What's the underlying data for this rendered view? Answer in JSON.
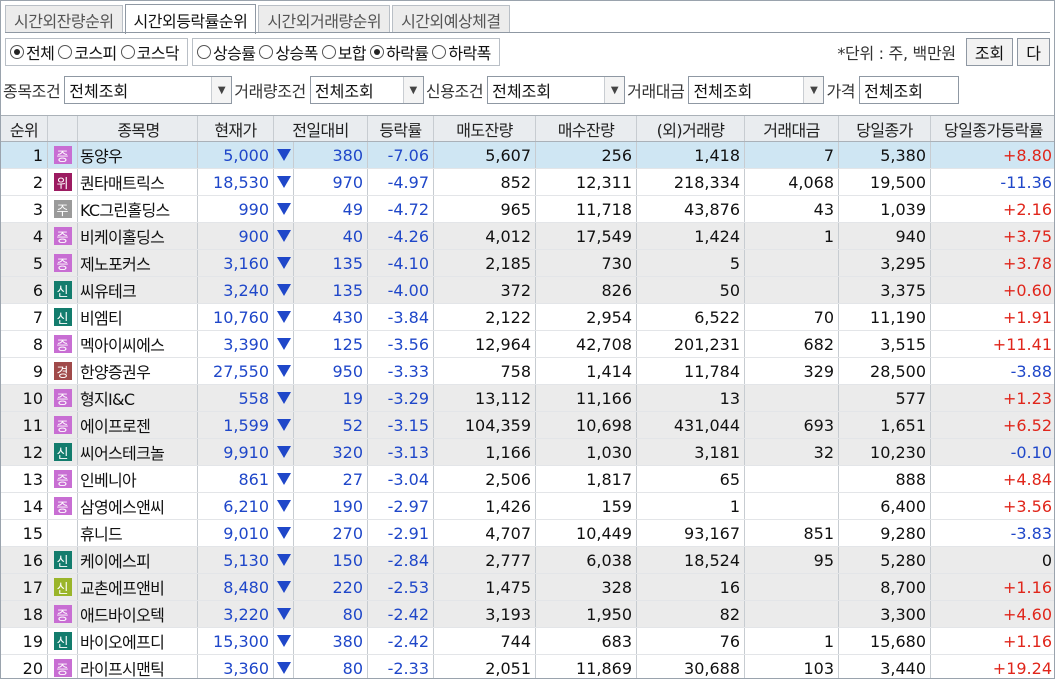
{
  "tabs": [
    "시간외잔량순위",
    "시간외등락률순위",
    "시간외거래량순위",
    "시간외예상체결"
  ],
  "active_tab": 1,
  "market_radios": [
    {
      "label": "전체",
      "checked": true
    },
    {
      "label": "코스피",
      "checked": false
    },
    {
      "label": "코스닥",
      "checked": false
    }
  ],
  "direction_radios": [
    {
      "label": "상승률",
      "checked": false
    },
    {
      "label": "상승폭",
      "checked": false
    },
    {
      "label": "보합",
      "checked": false
    },
    {
      "label": "하락률",
      "checked": true
    },
    {
      "label": "하락폭",
      "checked": false
    }
  ],
  "unit_label": "*단위 : 주, 백만원",
  "query_button": "조회",
  "next_button": "다",
  "filters": [
    {
      "label": "종목조건",
      "value": "전체조회"
    },
    {
      "label": "거래량조건",
      "value": "전체조회"
    },
    {
      "label": "신용조건",
      "value": "전체조회"
    },
    {
      "label": "거래대금",
      "value": "전체조회"
    },
    {
      "label": "가격",
      "value": "전체조회"
    }
  ],
  "columns": [
    "순위",
    "",
    "종목명",
    "현재가",
    "전일대비",
    "등락률",
    "매도잔량",
    "매수잔량",
    "(외)거래량",
    "거래대금",
    "당일종가",
    "당일종가등락률"
  ],
  "colors": {
    "down": "#1f47c9",
    "up": "#e0261b",
    "selected_row": "#cfe6f3",
    "badge_jeung": "#c86ed3",
    "badge_sin": "#137c6d",
    "badge_wi": "#9c1b61",
    "badge_ju": "#9a9a9a",
    "badge_gyeong": "#a04a4a",
    "badge_sin_light": "#9ab52a"
  },
  "rows": [
    {
      "rank": "1",
      "badge": "증",
      "badge_color": "#c86ed3",
      "name": "동양우",
      "price": "5,000",
      "change": "380",
      "rate": "-7.06",
      "sell": "5,607",
      "buy": "256",
      "volume": "1,418",
      "amount": "7",
      "close": "5,380",
      "close_rate": "+8.80",
      "close_color": "#e0261b"
    },
    {
      "rank": "2",
      "badge": "위",
      "badge_color": "#9c1b61",
      "name": "퀀타매트릭스",
      "price": "18,530",
      "change": "970",
      "rate": "-4.97",
      "sell": "852",
      "buy": "12,311",
      "volume": "218,334",
      "amount": "4,068",
      "close": "19,500",
      "close_rate": "-11.36",
      "close_color": "#1f47c9"
    },
    {
      "rank": "3",
      "badge": "주",
      "badge_color": "#9a9a9a",
      "name": "KC그린홀딩스",
      "price": "990",
      "change": "49",
      "rate": "-4.72",
      "sell": "965",
      "buy": "11,718",
      "volume": "43,876",
      "amount": "43",
      "close": "1,039",
      "close_rate": "+2.16",
      "close_color": "#e0261b"
    },
    {
      "rank": "4",
      "badge": "증",
      "badge_color": "#c86ed3",
      "name": "비케이홀딩스",
      "price": "900",
      "change": "40",
      "rate": "-4.26",
      "sell": "4,012",
      "buy": "17,549",
      "volume": "1,424",
      "amount": "1",
      "close": "940",
      "close_rate": "+3.75",
      "close_color": "#e0261b"
    },
    {
      "rank": "5",
      "badge": "증",
      "badge_color": "#c86ed3",
      "name": "제노포커스",
      "price": "3,160",
      "change": "135",
      "rate": "-4.10",
      "sell": "2,185",
      "buy": "730",
      "volume": "5",
      "amount": "",
      "close": "3,295",
      "close_rate": "+3.78",
      "close_color": "#e0261b"
    },
    {
      "rank": "6",
      "badge": "신",
      "badge_color": "#137c6d",
      "name": "씨유테크",
      "price": "3,240",
      "change": "135",
      "rate": "-4.00",
      "sell": "372",
      "buy": "826",
      "volume": "50",
      "amount": "",
      "close": "3,375",
      "close_rate": "+0.60",
      "close_color": "#e0261b"
    },
    {
      "rank": "7",
      "badge": "신",
      "badge_color": "#137c6d",
      "name": "비엠티",
      "price": "10,760",
      "change": "430",
      "rate": "-3.84",
      "sell": "2,122",
      "buy": "2,954",
      "volume": "6,522",
      "amount": "70",
      "close": "11,190",
      "close_rate": "+1.91",
      "close_color": "#e0261b"
    },
    {
      "rank": "8",
      "badge": "증",
      "badge_color": "#c86ed3",
      "name": "멕아이씨에스",
      "price": "3,390",
      "change": "125",
      "rate": "-3.56",
      "sell": "12,964",
      "buy": "42,708",
      "volume": "201,231",
      "amount": "682",
      "close": "3,515",
      "close_rate": "+11.41",
      "close_color": "#e0261b"
    },
    {
      "rank": "9",
      "badge": "경",
      "badge_color": "#a04a4a",
      "name": "한양증권우",
      "price": "27,550",
      "change": "950",
      "rate": "-3.33",
      "sell": "758",
      "buy": "1,414",
      "volume": "11,784",
      "amount": "329",
      "close": "28,500",
      "close_rate": "-3.88",
      "close_color": "#1f47c9"
    },
    {
      "rank": "10",
      "badge": "증",
      "badge_color": "#c86ed3",
      "name": "형지I&C",
      "price": "558",
      "change": "19",
      "rate": "-3.29",
      "sell": "13,112",
      "buy": "11,166",
      "volume": "13",
      "amount": "",
      "close": "577",
      "close_rate": "+1.23",
      "close_color": "#e0261b"
    },
    {
      "rank": "11",
      "badge": "증",
      "badge_color": "#c86ed3",
      "name": "에이프로젠",
      "price": "1,599",
      "change": "52",
      "rate": "-3.15",
      "sell": "104,359",
      "buy": "10,698",
      "volume": "431,044",
      "amount": "693",
      "close": "1,651",
      "close_rate": "+6.52",
      "close_color": "#e0261b"
    },
    {
      "rank": "12",
      "badge": "신",
      "badge_color": "#137c6d",
      "name": "씨어스테크놀",
      "price": "9,910",
      "change": "320",
      "rate": "-3.13",
      "sell": "1,166",
      "buy": "1,030",
      "volume": "3,181",
      "amount": "32",
      "close": "10,230",
      "close_rate": "-0.10",
      "close_color": "#1f47c9"
    },
    {
      "rank": "13",
      "badge": "증",
      "badge_color": "#c86ed3",
      "name": "인베니아",
      "price": "861",
      "change": "27",
      "rate": "-3.04",
      "sell": "2,506",
      "buy": "1,817",
      "volume": "65",
      "amount": "",
      "close": "888",
      "close_rate": "+4.84",
      "close_color": "#e0261b"
    },
    {
      "rank": "14",
      "badge": "증",
      "badge_color": "#c86ed3",
      "name": "삼영에스앤씨",
      "price": "6,210",
      "change": "190",
      "rate": "-2.97",
      "sell": "1,426",
      "buy": "159",
      "volume": "1",
      "amount": "",
      "close": "6,400",
      "close_rate": "+3.56",
      "close_color": "#e0261b"
    },
    {
      "rank": "15",
      "badge": "",
      "badge_color": "",
      "name": "휴니드",
      "price": "9,010",
      "change": "270",
      "rate": "-2.91",
      "sell": "4,707",
      "buy": "10,449",
      "volume": "93,167",
      "amount": "851",
      "close": "9,280",
      "close_rate": "-3.83",
      "close_color": "#1f47c9"
    },
    {
      "rank": "16",
      "badge": "신",
      "badge_color": "#137c6d",
      "name": "케이에스피",
      "price": "5,130",
      "change": "150",
      "rate": "-2.84",
      "sell": "2,777",
      "buy": "6,038",
      "volume": "18,524",
      "amount": "95",
      "close": "5,280",
      "close_rate": "0",
      "close_color": "#111111"
    },
    {
      "rank": "17",
      "badge": "신",
      "badge_color": "#9ab52a",
      "name": "교촌에프앤비",
      "price": "8,480",
      "change": "220",
      "rate": "-2.53",
      "sell": "1,475",
      "buy": "328",
      "volume": "16",
      "amount": "",
      "close": "8,700",
      "close_rate": "+1.16",
      "close_color": "#e0261b"
    },
    {
      "rank": "18",
      "badge": "증",
      "badge_color": "#c86ed3",
      "name": "애드바이오텍",
      "price": "3,220",
      "change": "80",
      "rate": "-2.42",
      "sell": "3,193",
      "buy": "1,950",
      "volume": "82",
      "amount": "",
      "close": "3,300",
      "close_rate": "+4.60",
      "close_color": "#e0261b"
    },
    {
      "rank": "19",
      "badge": "신",
      "badge_color": "#137c6d",
      "name": "바이오에프디",
      "price": "15,300",
      "change": "380",
      "rate": "-2.42",
      "sell": "744",
      "buy": "683",
      "volume": "76",
      "amount": "1",
      "close": "15,680",
      "close_rate": "+1.16",
      "close_color": "#e0261b"
    },
    {
      "rank": "20",
      "badge": "증",
      "badge_color": "#c86ed3",
      "name": "라이프시맨틱",
      "price": "3,360",
      "change": "80",
      "rate": "-2.33",
      "sell": "2,051",
      "buy": "11,869",
      "volume": "30,688",
      "amount": "103",
      "close": "3,440",
      "close_rate": "+19.24",
      "close_color": "#e0261b"
    }
  ]
}
